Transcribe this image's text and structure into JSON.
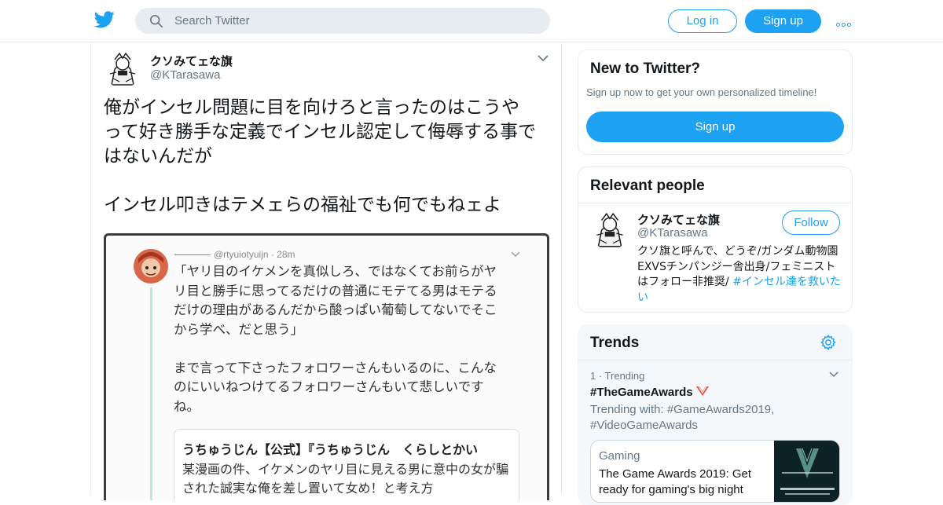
{
  "header": {
    "search_placeholder": "Search Twitter",
    "login_label": "Log in",
    "signup_label": "Sign up",
    "brand_color": "#1da1f2"
  },
  "tweet": {
    "display_name": "クソみてェな旗",
    "handle": "@KTarasawa",
    "text": "俺がインセル問題に目を向けろと言ったのはこうや\nって好き勝手な定義でインセル認定して侮辱する事で\nはないんだが\n\nインセル叩きはテメェらの福祉でも何でもねェよ",
    "media": {
      "screenshot_handle": "@rtyuiotyuijn · 28m",
      "screenshot_text": "「ヤリ目のイケメンを真似しろ、ではなくてお前らがヤ\nリ目と勝手に思ってるだけの普通にモテてる男はモテる\nだけの理由があるんだから酸っぱい葡萄してないでそこ\nから学べ、だと思う」\n\nまで言って下さったフォロワーさんもいるのに、こんな\nのにいいねつけてるフォロワーさんもいて悲しいです\nね。",
      "quoted_name": "うちゅうじん【公式】『うちゅうじん　くらしとかい",
      "quoted_text": "某漫画の件、イケメンのヤリ目に見える男に意中の女が騙された誠実な俺を差し置いて女め！と考え方"
    }
  },
  "sidebar": {
    "new_to_twitter": {
      "title": "New to Twitter?",
      "subtitle": "Sign up now to get your own personalized timeline!",
      "signup_label": "Sign up"
    },
    "relevant_people": {
      "title": "Relevant people",
      "name": "クソみてェな旗",
      "handle": "@KTarasawa",
      "follow_label": "Follow",
      "bio": "クソ旗と呼んで、どうぞ/ガンダム動物園EXVSチンパンジー舎出身/フェミニストはフォロー非推奨/ ",
      "bio_hashtag": "#インセル達を救いたい"
    },
    "trends": {
      "title": "Trends",
      "items": [
        {
          "rank_label": "1 · Trending",
          "name": "#TheGameAwards",
          "trending_with": "Trending with: #GameAwards2019, #VideoGameAwards",
          "news": {
            "category": "Gaming",
            "headline": "The Game Awards 2019: Get ready for gaming's big night"
          }
        }
      ]
    }
  }
}
